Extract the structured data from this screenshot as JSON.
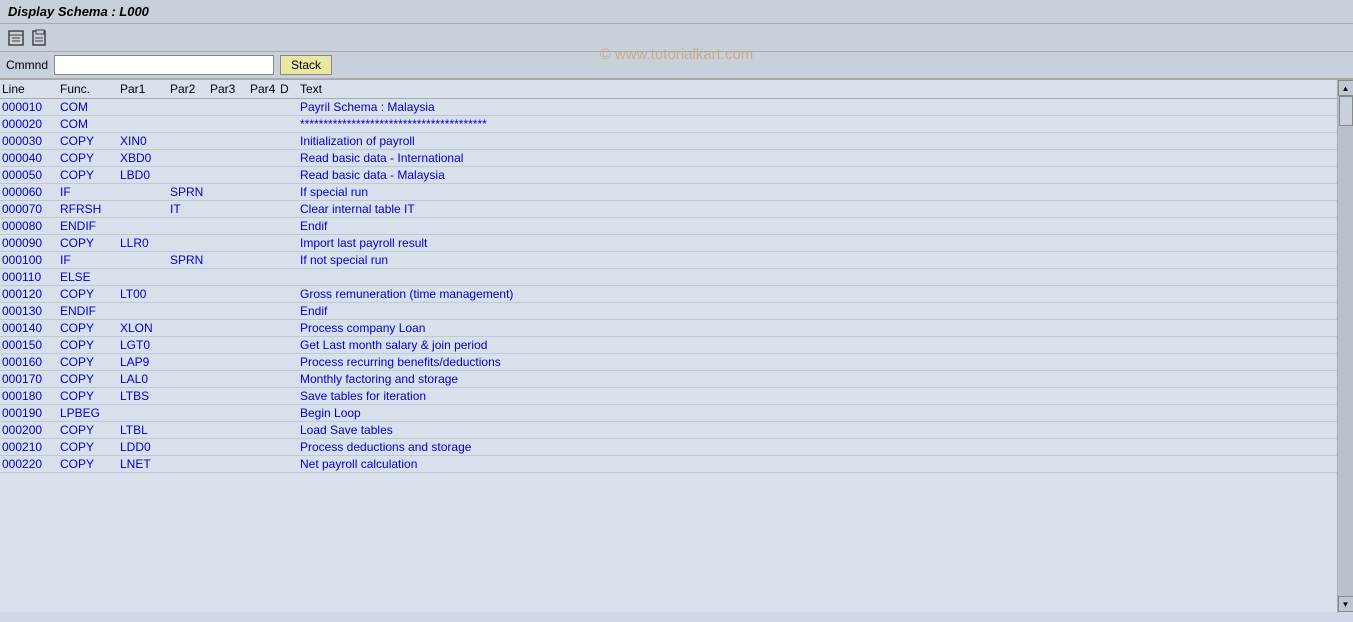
{
  "titleBar": {
    "title": "Display Schema : L000"
  },
  "watermark": "© www.tutorialkart.com",
  "commandBar": {
    "label": "Cmmnd",
    "placeholder": "",
    "stackButton": "Stack"
  },
  "tableHeader": {
    "line": "Line",
    "func": "Func.",
    "par1": "Par1",
    "par2": "Par2",
    "par3": "Par3",
    "par4": "Par4",
    "d": "D",
    "text": "Text"
  },
  "rows": [
    {
      "line": "000010",
      "func": "COM",
      "par1": "",
      "par2": "",
      "par3": "",
      "par4": "",
      "d": "",
      "text": "Payril Schema : Malaysia"
    },
    {
      "line": "000020",
      "func": "COM",
      "par1": "",
      "par2": "",
      "par3": "",
      "par4": "",
      "d": "",
      "text": "****************************************"
    },
    {
      "line": "000030",
      "func": "COPY",
      "par1": "XIN0",
      "par2": "",
      "par3": "",
      "par4": "",
      "d": "",
      "text": "Initialization of payroll"
    },
    {
      "line": "000040",
      "func": "COPY",
      "par1": "XBD0",
      "par2": "",
      "par3": "",
      "par4": "",
      "d": "",
      "text": "Read basic data - International"
    },
    {
      "line": "000050",
      "func": "COPY",
      "par1": "LBD0",
      "par2": "",
      "par3": "",
      "par4": "",
      "d": "",
      "text": "Read basic data - Malaysia"
    },
    {
      "line": "000060",
      "func": "IF",
      "par1": "",
      "par2": "SPRN",
      "par3": "",
      "par4": "",
      "d": "",
      "text": "If special run"
    },
    {
      "line": "000070",
      "func": "RFRSH",
      "par1": "",
      "par2": "IT",
      "par3": "",
      "par4": "",
      "d": "",
      "text": "  Clear internal table IT"
    },
    {
      "line": "000080",
      "func": "ENDIF",
      "par1": "",
      "par2": "",
      "par3": "",
      "par4": "",
      "d": "",
      "text": "Endif"
    },
    {
      "line": "000090",
      "func": "COPY",
      "par1": "LLR0",
      "par2": "",
      "par3": "",
      "par4": "",
      "d": "",
      "text": "Import last payroll result"
    },
    {
      "line": "000100",
      "func": "IF",
      "par1": "",
      "par2": "SPRN",
      "par3": "",
      "par4": "",
      "d": "",
      "text": "If not special run"
    },
    {
      "line": "000110",
      "func": "ELSE",
      "par1": "",
      "par2": "",
      "par3": "",
      "par4": "",
      "d": "",
      "text": ""
    },
    {
      "line": "000120",
      "func": "COPY",
      "par1": "LT00",
      "par2": "",
      "par3": "",
      "par4": "",
      "d": "",
      "text": "  Gross remuneration (time management)"
    },
    {
      "line": "000130",
      "func": "ENDIF",
      "par1": "",
      "par2": "",
      "par3": "",
      "par4": "",
      "d": "",
      "text": "Endif"
    },
    {
      "line": "000140",
      "func": "COPY",
      "par1": "XLON",
      "par2": "",
      "par3": "",
      "par4": "",
      "d": "",
      "text": "Process company Loan"
    },
    {
      "line": "000150",
      "func": "COPY",
      "par1": "LGT0",
      "par2": "",
      "par3": "",
      "par4": "",
      "d": "",
      "text": "Get Last month salary & join period"
    },
    {
      "line": "000160",
      "func": "COPY",
      "par1": "LAP9",
      "par2": "",
      "par3": "",
      "par4": "",
      "d": "",
      "text": "  Process recurring benefits/deductions"
    },
    {
      "line": "000170",
      "func": "COPY",
      "par1": "LAL0",
      "par2": "",
      "par3": "",
      "par4": "",
      "d": "",
      "text": "  Monthly factoring and storage"
    },
    {
      "line": "000180",
      "func": "COPY",
      "par1": "LTBS",
      "par2": "",
      "par3": "",
      "par4": "",
      "d": "",
      "text": "Save tables for iteration"
    },
    {
      "line": "000190",
      "func": "LPBEG",
      "par1": "",
      "par2": "",
      "par3": "",
      "par4": "",
      "d": "",
      "text": "Begin Loop"
    },
    {
      "line": "000200",
      "func": "COPY",
      "par1": "LTBL",
      "par2": "",
      "par3": "",
      "par4": "",
      "d": "",
      "text": "  Load Save tables"
    },
    {
      "line": "000210",
      "func": "COPY",
      "par1": "LDD0",
      "par2": "",
      "par3": "",
      "par4": "",
      "d": "",
      "text": "  Process deductions and storage"
    },
    {
      "line": "000220",
      "func": "COPY",
      "par1": "LNET",
      "par2": "",
      "par3": "",
      "par4": "",
      "d": "",
      "text": "Net payroll calculation"
    }
  ],
  "icons": {
    "toolbar1": "⚙",
    "toolbar2": "📋",
    "scrollUp": "▲",
    "scrollDown": "▼"
  }
}
